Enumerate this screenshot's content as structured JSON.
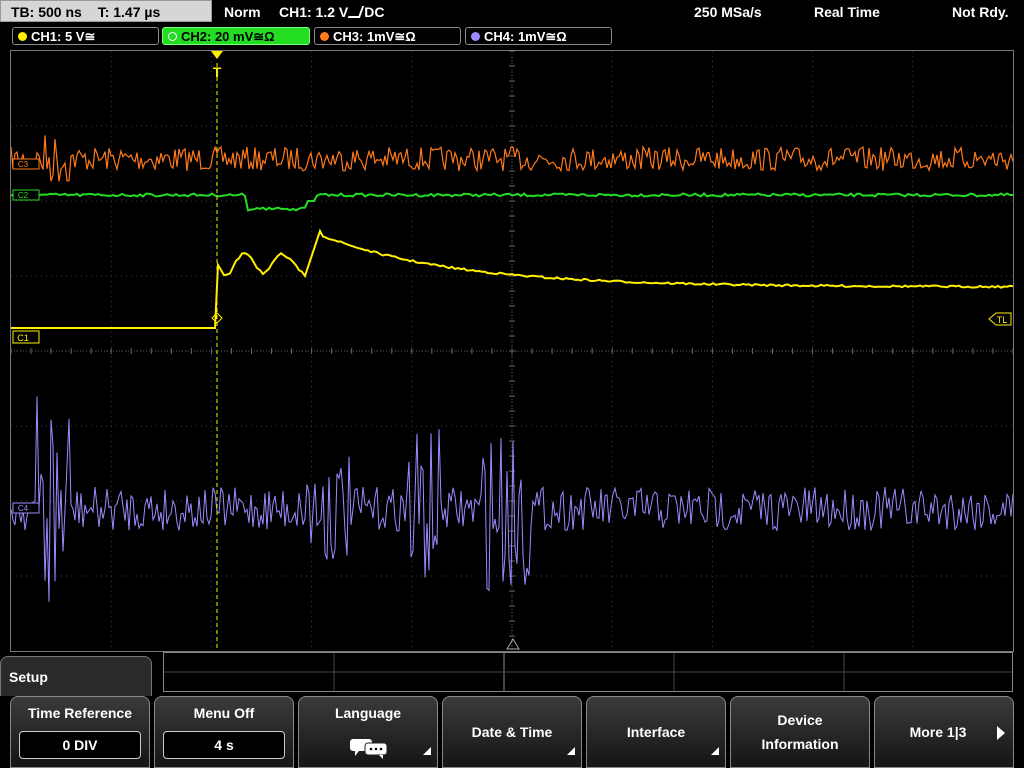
{
  "topbar": {
    "timebase": "TB: 500 ns",
    "trigger_time": "T: 1.47 µs",
    "trigger_mode": "Norm",
    "trigger_level": "CH1: 1.2 V",
    "trigger_slope": "⎍",
    "trigger_coupling": "DC",
    "sample_rate": "250 MSa/s",
    "acq_mode": "Real Time",
    "status": "Not Rdy."
  },
  "channels": [
    {
      "label": "CH1: 5 V≅",
      "color": "#ffee00"
    },
    {
      "label": "CH2: 20 mV≅Ω",
      "color": "#22dd22"
    },
    {
      "label": "CH3: 1mV≅Ω",
      "color": "#ff7a1a"
    },
    {
      "label": "CH4: 1mV≅Ω",
      "color": "#9a8cff"
    }
  ],
  "markers": {
    "trigger_t": "T",
    "trigger_level_label": "TL",
    "ch1_label": "C1",
    "ch2_label": "C2",
    "ch3_label": "C3",
    "ch4_label": "C4"
  },
  "menu": {
    "title": "Setup",
    "keys": [
      {
        "label": "Time Reference",
        "value": "0 DIV"
      },
      {
        "label": "Menu Off",
        "value": "4 s"
      },
      {
        "label": "Language",
        "icon": "speech-bubble-icon"
      },
      {
        "label": "Date & Time"
      },
      {
        "label": "Interface"
      },
      {
        "label": "Device",
        "label2": "Information"
      },
      {
        "label": "More 1|3",
        "icon": "arrow-right-icon"
      }
    ]
  }
}
